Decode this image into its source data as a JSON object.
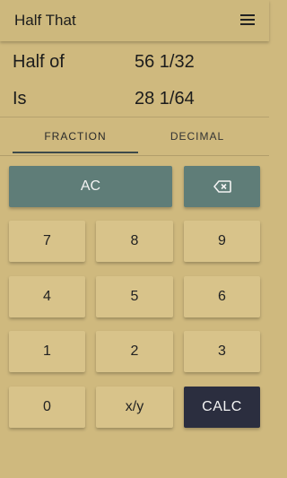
{
  "app": {
    "title": "Half That"
  },
  "result": {
    "input_label": "Half of",
    "input_value": "56 1/32",
    "output_label": "Is",
    "output_value": "28 1/64"
  },
  "tabs": [
    {
      "label": "FRACTION",
      "active": true
    },
    {
      "label": "DECIMAL",
      "active": false
    }
  ],
  "keypad": {
    "ac_label": "AC",
    "backspace_icon": "backspace-icon",
    "digits": [
      "7",
      "8",
      "9",
      "4",
      "5",
      "6",
      "1",
      "2",
      "3",
      "0"
    ],
    "fraction_label": "x/y",
    "calc_label": "CALC"
  },
  "colors": {
    "background": "#cfb97e",
    "key": "#d8c38a",
    "accent_teal": "#5f7d78",
    "calc_dark": "#2b2e3f"
  }
}
